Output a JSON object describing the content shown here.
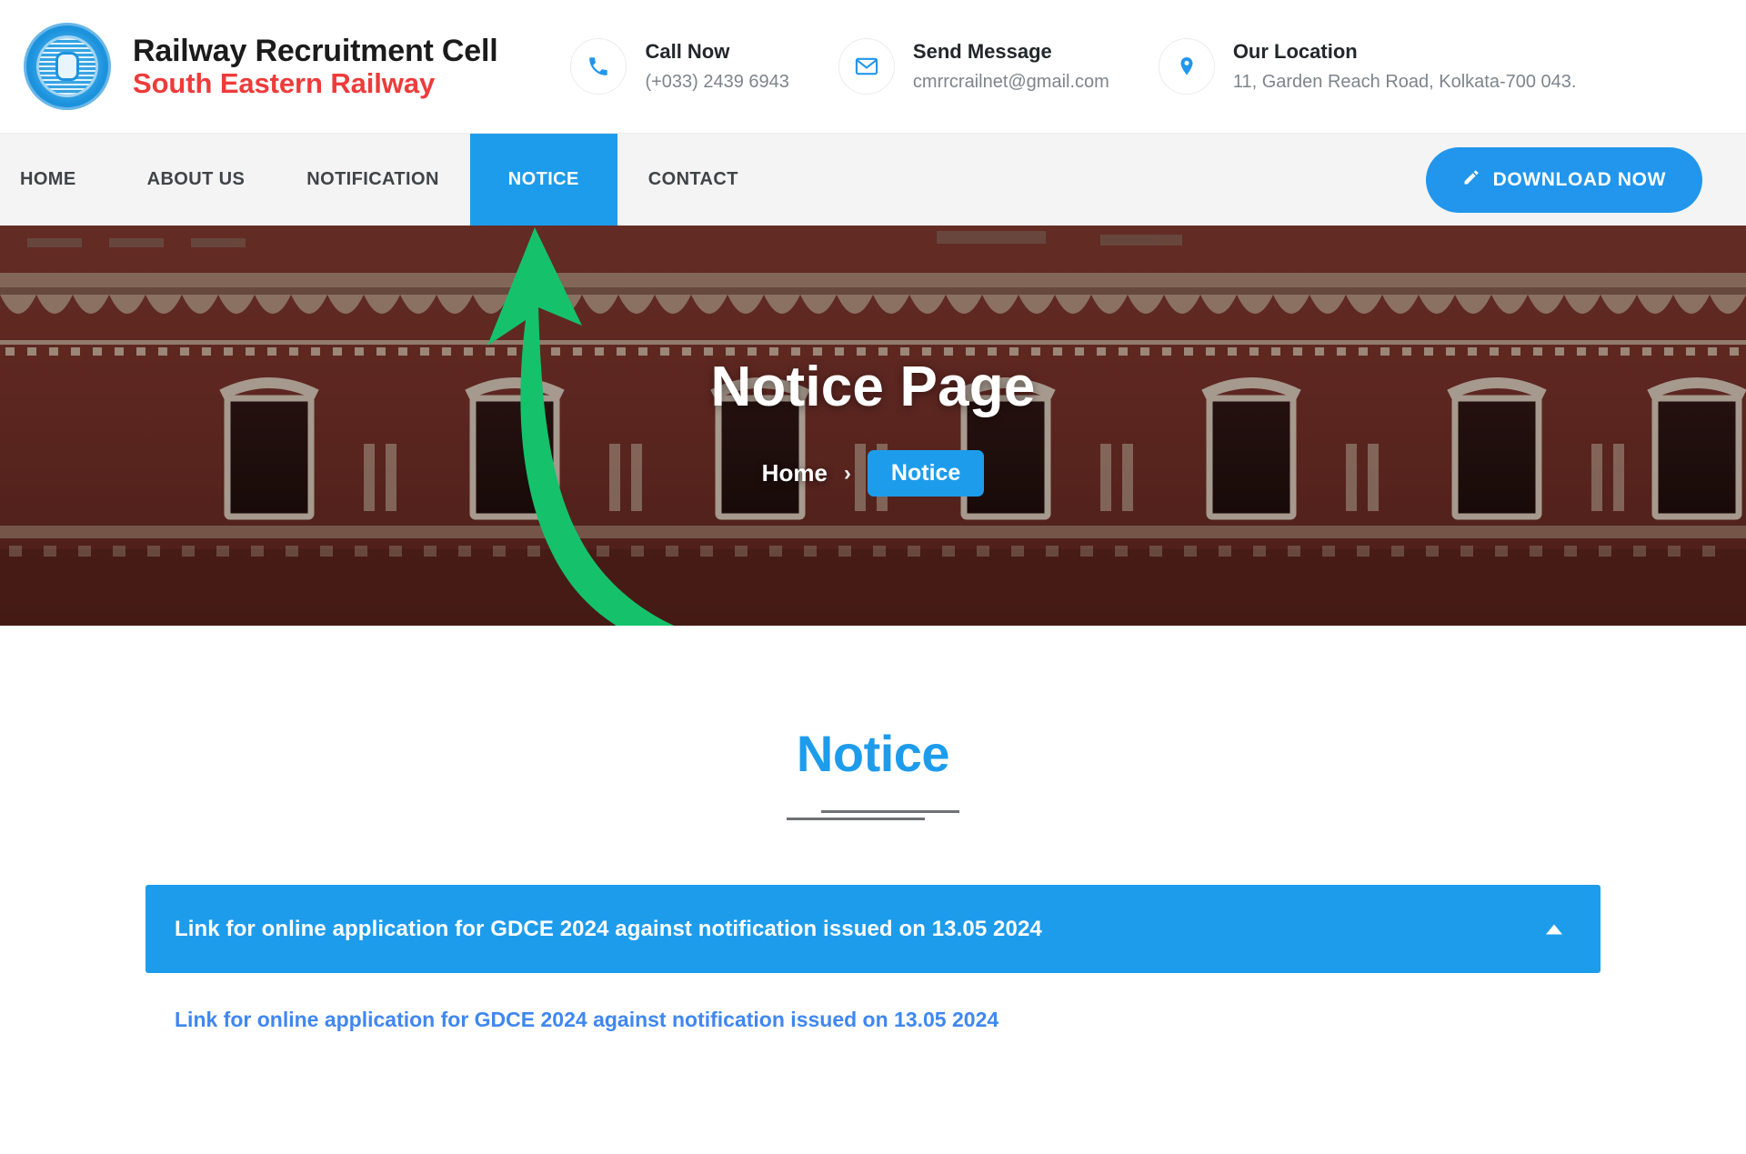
{
  "header": {
    "logo_icon": "railway-emblem-icon",
    "brand_line1": "Railway Recruitment Cell",
    "brand_line2": "South Eastern Railway",
    "contacts": [
      {
        "icon": "phone-icon",
        "title": "Call Now",
        "value": "(+033) 2439 6943"
      },
      {
        "icon": "envelope-icon",
        "title": "Send Message",
        "value": "cmrrcrailnet@gmail.com"
      },
      {
        "icon": "map-pin-icon",
        "title": "Our Location",
        "value": "11, Garden Reach Road, Kolkata-700 043."
      }
    ]
  },
  "nav": {
    "items": [
      {
        "label": "HOME",
        "active": false
      },
      {
        "label": "ABOUT US",
        "active": false
      },
      {
        "label": "NOTIFICATION",
        "active": false
      },
      {
        "label": "NOTICE",
        "active": true
      },
      {
        "label": "CONTACT",
        "active": false
      }
    ],
    "download_label": "DOWNLOAD NOW",
    "download_icon": "pencil-icon",
    "active_bg": "#1e9cec",
    "bar_bg": "#f4f4f4"
  },
  "hero": {
    "title": "Notice Page",
    "breadcrumb_home": "Home",
    "breadcrumb_separator": "›",
    "breadcrumb_current": "Notice",
    "annotation_icon": "curved-arrow-annotation",
    "annotation_color": "#15c26b"
  },
  "main": {
    "section_title": "Notice",
    "section_title_color": "#1e9cec",
    "accordion": {
      "header_label": "Link for online application for GDCE 2024 against notification issued on 13.05 2024",
      "header_bg": "#1e9cec",
      "caret_icon": "chevron-up-icon",
      "expanded": true,
      "link_label": "Link for online application for GDCE 2024 against notification issued on 13.05 2024",
      "link_color": "#3f87f0"
    }
  }
}
